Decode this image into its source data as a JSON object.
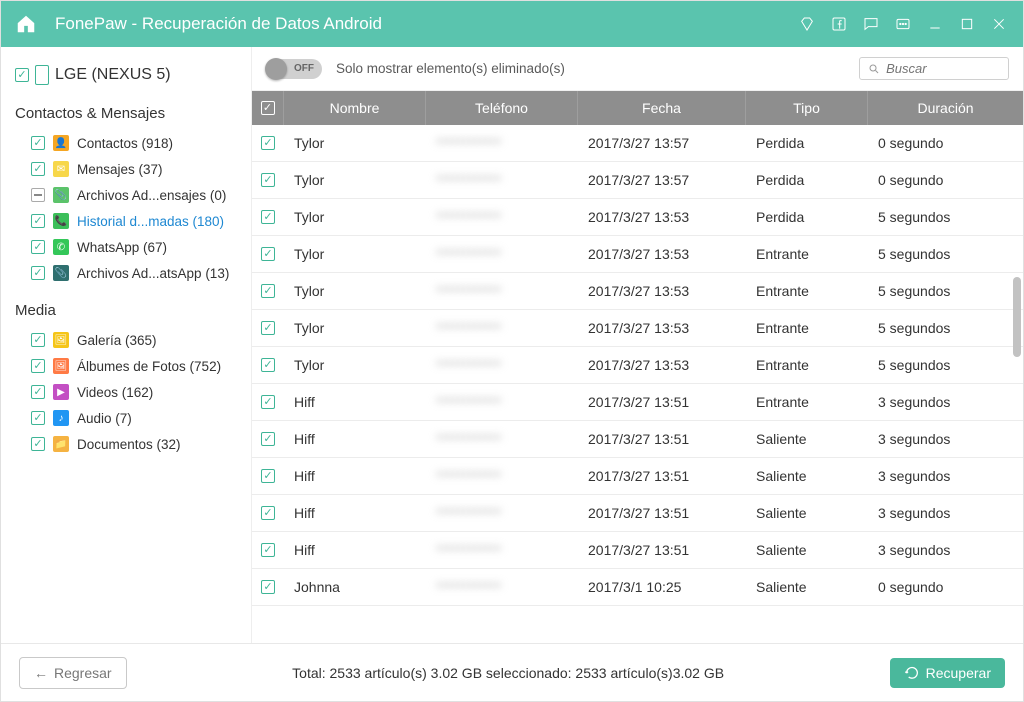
{
  "app_title": "FonePaw - Recuperación de Datos Android",
  "device_name": "LGE (NEXUS 5)",
  "sections": {
    "contacts": {
      "title": "Contactos & Mensajes",
      "items": [
        {
          "label": "Contactos (918)",
          "color": "#f5a623",
          "glyph": "👤",
          "checked": true
        },
        {
          "label": "Mensajes (37)",
          "color": "#f7d74a",
          "glyph": "✉",
          "checked": true
        },
        {
          "label": "Archivos Ad...ensajes (0)",
          "color": "#5bc36a",
          "glyph": "📎",
          "checked": "minus"
        },
        {
          "label": "Historial d...madas (180)",
          "color": "#3cbf5a",
          "glyph": "📞",
          "checked": true,
          "active": true
        },
        {
          "label": "WhatsApp (67)",
          "color": "#34c759",
          "glyph": "✆",
          "checked": true
        },
        {
          "label": "Archivos Ad...atsApp (13)",
          "color": "#2f6f6f",
          "glyph": "📎",
          "checked": true
        }
      ]
    },
    "media": {
      "title": "Media",
      "items": [
        {
          "label": "Galería (365)",
          "color": "#f5c518",
          "glyph": "🖼",
          "checked": true
        },
        {
          "label": "Álbumes de Fotos (752)",
          "color": "#ff7a45",
          "glyph": "🖼",
          "checked": true
        },
        {
          "label": "Videos (162)",
          "color": "#c34fc3",
          "glyph": "▶",
          "checked": true
        },
        {
          "label": "Audio (7)",
          "color": "#2196f3",
          "glyph": "♪",
          "checked": true
        },
        {
          "label": "Documentos (32)",
          "color": "#f5b342",
          "glyph": "📁",
          "checked": true
        }
      ]
    }
  },
  "toolbar": {
    "toggle_state": "OFF",
    "toggle_text": "Solo mostrar elemento(s) eliminado(s)",
    "search_placeholder": "Buscar"
  },
  "columns": {
    "name": "Nombre",
    "tel": "Teléfono",
    "fecha": "Fecha",
    "tipo": "Tipo",
    "dur": "Duración"
  },
  "rows": [
    {
      "name": "Tylor",
      "fecha": "2017/3/27 13:57",
      "tipo": "Perdida",
      "dur": "0 segundo"
    },
    {
      "name": "Tylor",
      "fecha": "2017/3/27 13:57",
      "tipo": "Perdida",
      "dur": "0 segundo"
    },
    {
      "name": "Tylor",
      "fecha": "2017/3/27 13:53",
      "tipo": "Perdida",
      "dur": "5 segundos"
    },
    {
      "name": "Tylor",
      "fecha": "2017/3/27 13:53",
      "tipo": "Entrante",
      "dur": "5 segundos"
    },
    {
      "name": "Tylor",
      "fecha": "2017/3/27 13:53",
      "tipo": "Entrante",
      "dur": "5 segundos"
    },
    {
      "name": "Tylor",
      "fecha": "2017/3/27 13:53",
      "tipo": "Entrante",
      "dur": "5 segundos"
    },
    {
      "name": "Tylor",
      "fecha": "2017/3/27 13:53",
      "tipo": "Entrante",
      "dur": "5 segundos"
    },
    {
      "name": "Hiff",
      "fecha": "2017/3/27 13:51",
      "tipo": "Entrante",
      "dur": "3 segundos"
    },
    {
      "name": "Hiff",
      "fecha": "2017/3/27 13:51",
      "tipo": "Saliente",
      "dur": "3 segundos"
    },
    {
      "name": "Hiff",
      "fecha": "2017/3/27 13:51",
      "tipo": "Saliente",
      "dur": "3 segundos"
    },
    {
      "name": "Hiff",
      "fecha": "2017/3/27 13:51",
      "tipo": "Saliente",
      "dur": "3 segundos"
    },
    {
      "name": "Hiff",
      "fecha": "2017/3/27 13:51",
      "tipo": "Saliente",
      "dur": "3 segundos"
    },
    {
      "name": "Johnna",
      "fecha": "2017/3/1 10:25",
      "tipo": "Saliente",
      "dur": "0 segundo"
    }
  ],
  "footer": {
    "back": "Regresar",
    "summary": "Total: 2533 artículo(s) 3.02 GB seleccionado: 2533 artículo(s)3.02 GB",
    "recover": "Recuperar"
  }
}
